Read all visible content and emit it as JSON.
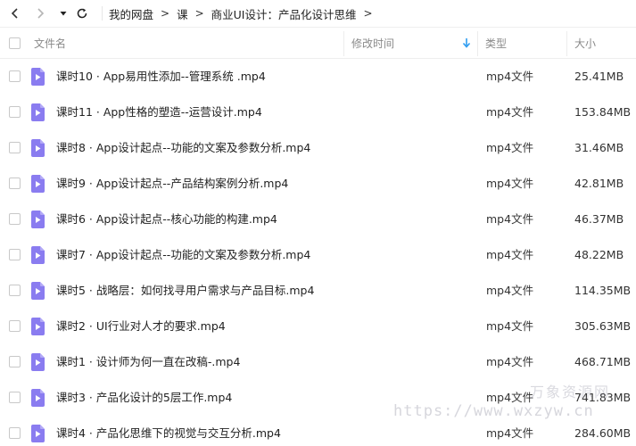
{
  "breadcrumb": [
    "我的网盘",
    "课",
    "商业UI设计：产品化设计思维"
  ],
  "breadcrumb_separator": ">",
  "header": {
    "name": "文件名",
    "modified": "修改时间",
    "type": "类型",
    "size": "大小"
  },
  "icons": {
    "back": "chevron-left-icon",
    "forward": "chevron-right-icon",
    "history": "caret-down-icon",
    "refresh": "refresh-icon",
    "file": "video-file-icon"
  },
  "colors": {
    "file_icon": "#8a7cf0",
    "sort_arrow": "#2e9cf0"
  },
  "files": [
    {
      "name": "课时10 · App易用性添加--管理系统 .mp4",
      "type": "mp4文件",
      "size": "25.41MB"
    },
    {
      "name": "课时11 · App性格的塑造--运营设计.mp4",
      "type": "mp4文件",
      "size": "153.84MB"
    },
    {
      "name": "课时8 · App设计起点--功能的文案及参数分析.mp4",
      "type": "mp4文件",
      "size": "31.46MB"
    },
    {
      "name": "课时9 · App设计起点--产品结构案例分析.mp4",
      "type": "mp4文件",
      "size": "42.81MB"
    },
    {
      "name": "课时6 · App设计起点--核心功能的构建.mp4",
      "type": "mp4文件",
      "size": "46.37MB"
    },
    {
      "name": "课时7 · App设计起点--功能的文案及参数分析.mp4",
      "type": "mp4文件",
      "size": "48.22MB"
    },
    {
      "name": "课时5 · 战略层：如何找寻用户需求与产品目标.mp4",
      "type": "mp4文件",
      "size": "114.35MB"
    },
    {
      "name": "课时2 · UI行业对人才的要求.mp4",
      "type": "mp4文件",
      "size": "305.63MB"
    },
    {
      "name": "课时1 · 设计师为何一直在改稿-.mp4",
      "type": "mp4文件",
      "size": "468.71MB"
    },
    {
      "name": "课时3 · 产品化设计的5层工作.mp4",
      "type": "mp4文件",
      "size": "741.83MB"
    },
    {
      "name": "课时4 · 产品化思维下的视觉与交互分析.mp4",
      "type": "mp4文件",
      "size": "284.60MB"
    }
  ],
  "watermark": {
    "text": "万象资源网",
    "url": "https://www.wxzyw.cn"
  }
}
